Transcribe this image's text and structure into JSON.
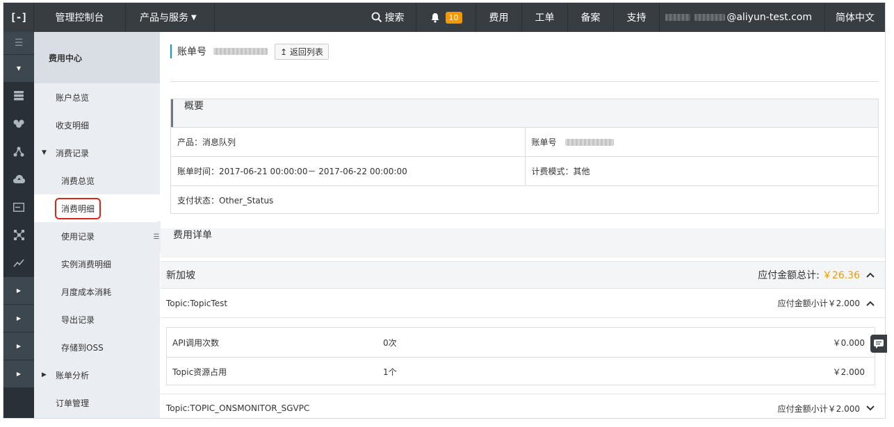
{
  "topbar": {
    "console": "管理控制台",
    "products": "产品与服务",
    "search": "搜索",
    "notification_count": "10",
    "fee": "费用",
    "ticket": "工单",
    "beian": "备案",
    "support": "支持",
    "user_email_suffix": "@aliyun-test.com",
    "language": "简体中文"
  },
  "subnav": {
    "title": "费用中心",
    "items": [
      {
        "label": "账户总览"
      },
      {
        "label": "收支明细"
      },
      {
        "label": "消费记录"
      },
      {
        "label": "消费总览"
      },
      {
        "label": "消费明细"
      },
      {
        "label": "使用记录"
      },
      {
        "label": "实例消费明细"
      },
      {
        "label": "月度成本消耗"
      },
      {
        "label": "导出记录"
      },
      {
        "label": "存储到OSS"
      },
      {
        "label": "账单分析"
      },
      {
        "label": "订单管理"
      }
    ]
  },
  "main": {
    "bill_no_label": "账单号",
    "back_button": "返回列表",
    "overview": {
      "title": "概要",
      "product": "产品：消息队列",
      "bill_no_label": "账单号",
      "bill_time": "账单时间：2017-06-21 00:00:00－ 2017-06-22 00:00:00",
      "billing_mode": "计费模式：其他",
      "pay_status": "支付状态：Other_Status"
    },
    "detail_title": "费用详单",
    "region": {
      "name": "新加坡",
      "total_label": "应付金额总计:",
      "total_value": "￥26.36"
    },
    "topics": [
      {
        "name": "Topic:TopicTest",
        "subtotal": "应付金额小计￥2.000"
      },
      {
        "name": "Topic:TOPIC_ONSMONITOR_SGVPC",
        "subtotal": "应付金额小计￥2.000"
      }
    ],
    "items": [
      {
        "name": "API调用次数",
        "qty": "0次",
        "amount": "￥0.000"
      },
      {
        "name": "Topic资源占用",
        "qty": "1个",
        "amount": "￥2.000"
      }
    ]
  },
  "colors": {
    "topbar_bg": "#373d41",
    "accent_orange": "#f39800",
    "active_outline": "#d9261c"
  }
}
